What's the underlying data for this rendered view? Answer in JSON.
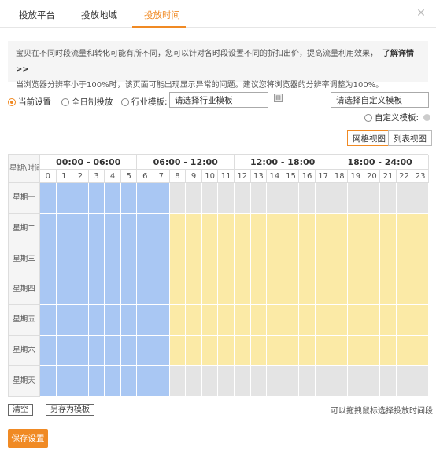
{
  "tabs": [
    {
      "label": "投放平台",
      "active": false
    },
    {
      "label": "投放地域",
      "active": false
    },
    {
      "label": "投放时间",
      "active": true
    }
  ],
  "notice": {
    "line1": "宝贝在不同时段流量和转化可能有所不同，您可以针对各时段设置不同的折扣出价，提高流量利用效果，",
    "link": "了解详情 >>",
    "line2": "当浏览器分辨率小于100%时，该页面可能出现显示异常的问题。建议您将浏览器的分辨率调整为100%。"
  },
  "options": {
    "current": "当前设置",
    "fullday": "全日制投放",
    "industry": "行业模板:",
    "industry_placeholder": "请选择行业模板",
    "custom_select": "请选择自定义模板",
    "custom_label": "自定义模板:",
    "selected": "current"
  },
  "views": {
    "grid": "网格视图",
    "list": "列表视图",
    "active": "grid"
  },
  "schedule": {
    "corner": "星期\\时间",
    "periods": [
      "00:00 - 06:00",
      "06:00 - 12:00",
      "12:00 - 18:00",
      "18:00 - 24:00"
    ],
    "hours": [
      "0",
      "1",
      "2",
      "3",
      "4",
      "5",
      "6",
      "7",
      "8",
      "9",
      "10",
      "11",
      "12",
      "13",
      "14",
      "15",
      "16",
      "17",
      "18",
      "19",
      "20",
      "21",
      "22",
      "23"
    ],
    "days": [
      "星期一",
      "星期二",
      "星期三",
      "星期四",
      "星期五",
      "星期六",
      "星期天"
    ],
    "colors": {
      "blue": "#a9c7f3",
      "yellow": "#fbeaa6",
      "gray": "#e4e4e4"
    },
    "rows": [
      [
        "b",
        "b",
        "b",
        "b",
        "b",
        "b",
        "b",
        "b",
        "g",
        "g",
        "g",
        "g",
        "g",
        "g",
        "g",
        "g",
        "g",
        "g",
        "g",
        "g",
        "g",
        "g",
        "g",
        "g"
      ],
      [
        "b",
        "b",
        "b",
        "b",
        "b",
        "b",
        "b",
        "b",
        "y",
        "y",
        "y",
        "y",
        "y",
        "y",
        "y",
        "y",
        "y",
        "y",
        "y",
        "y",
        "y",
        "y",
        "y",
        "y"
      ],
      [
        "b",
        "b",
        "b",
        "b",
        "b",
        "b",
        "b",
        "b",
        "y",
        "y",
        "y",
        "y",
        "y",
        "y",
        "y",
        "y",
        "y",
        "y",
        "y",
        "y",
        "y",
        "y",
        "y",
        "y"
      ],
      [
        "b",
        "b",
        "b",
        "b",
        "b",
        "b",
        "b",
        "b",
        "y",
        "y",
        "y",
        "y",
        "y",
        "y",
        "y",
        "y",
        "y",
        "y",
        "y",
        "y",
        "y",
        "y",
        "y",
        "y"
      ],
      [
        "b",
        "b",
        "b",
        "b",
        "b",
        "b",
        "b",
        "b",
        "y",
        "y",
        "y",
        "y",
        "y",
        "y",
        "y",
        "y",
        "y",
        "y",
        "y",
        "y",
        "y",
        "y",
        "y",
        "y"
      ],
      [
        "b",
        "b",
        "b",
        "b",
        "b",
        "b",
        "b",
        "b",
        "y",
        "y",
        "y",
        "y",
        "y",
        "y",
        "y",
        "y",
        "y",
        "y",
        "y",
        "y",
        "y",
        "y",
        "y",
        "y"
      ],
      [
        "b",
        "b",
        "b",
        "b",
        "b",
        "b",
        "b",
        "b",
        "g",
        "g",
        "g",
        "g",
        "g",
        "g",
        "g",
        "g",
        "g",
        "g",
        "g",
        "g",
        "g",
        "g",
        "g",
        "g"
      ]
    ]
  },
  "actions": {
    "clear": "清空",
    "save_template": "另存为模板",
    "hint": "可以拖拽鼠标选择投放时间段",
    "save": "保存设置"
  }
}
